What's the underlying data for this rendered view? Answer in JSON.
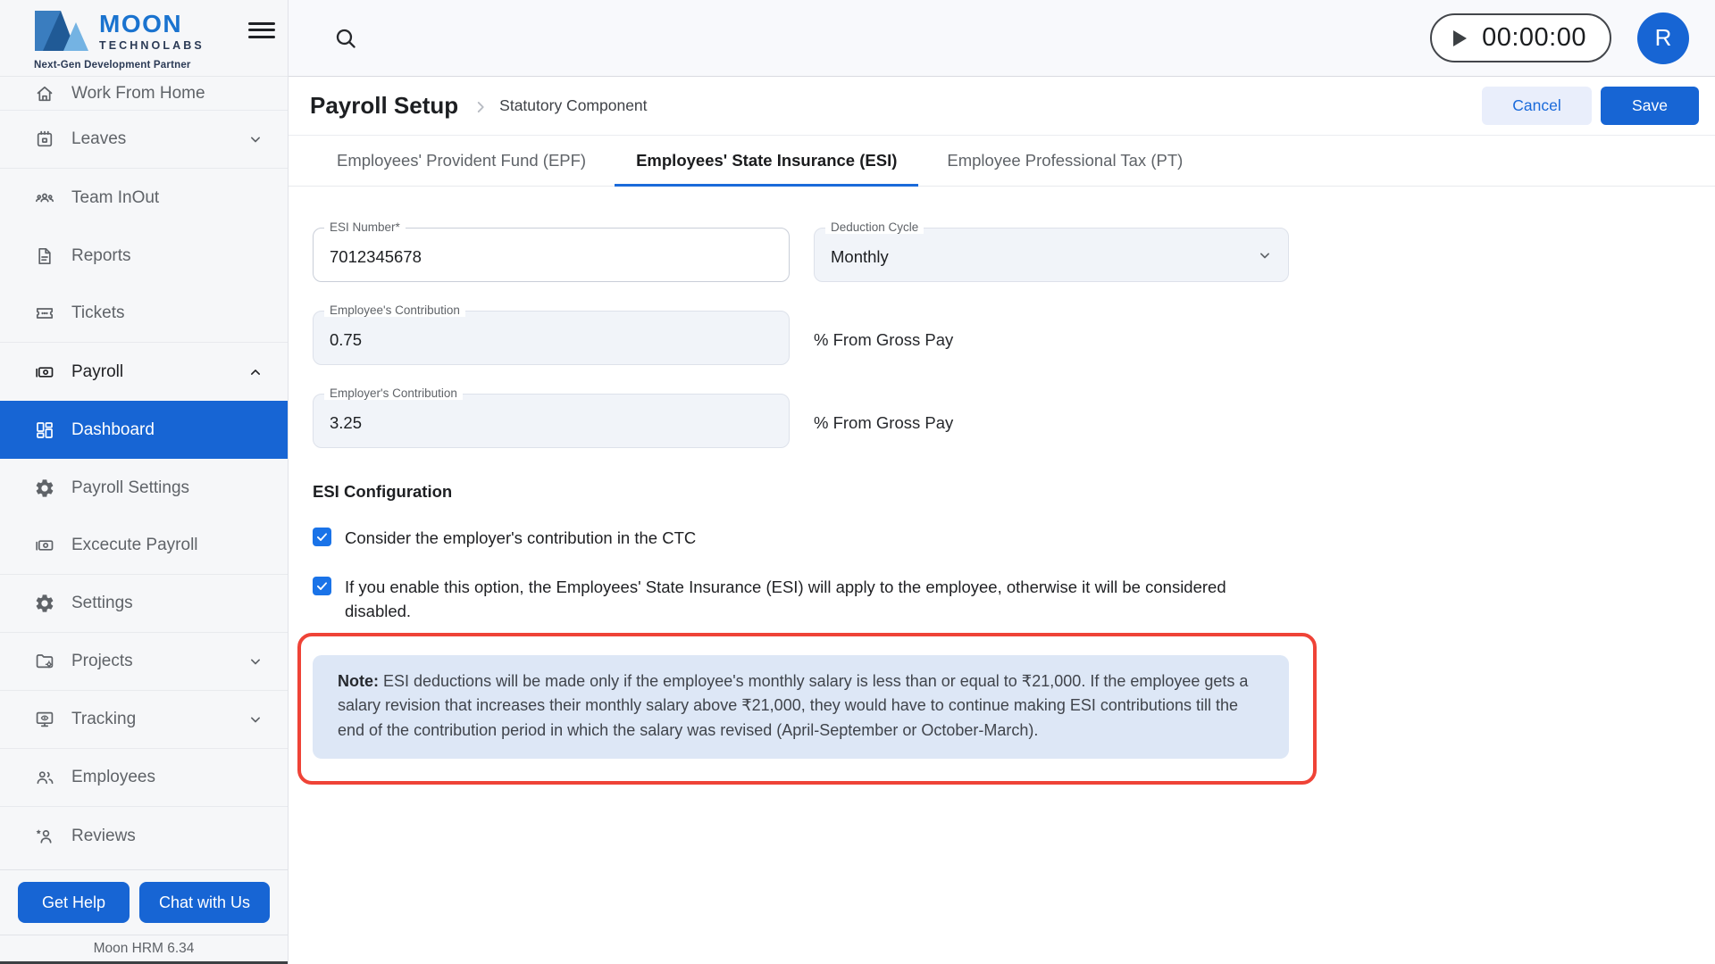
{
  "brand": {
    "name": "MOON",
    "subname": "TECHNOLABS",
    "tagline": "Next-Gen Development Partner"
  },
  "topbar": {
    "timer": "00:00:00",
    "avatar_initial": "R"
  },
  "sidebar": {
    "items": [
      {
        "label": "Work From Home",
        "icon": "home-icon"
      },
      {
        "label": "Leaves",
        "icon": "calendar-icon",
        "chevron": "down"
      },
      {
        "label": "Team InOut",
        "icon": "groups-icon"
      },
      {
        "label": "Reports",
        "icon": "document-icon"
      },
      {
        "label": "Tickets",
        "icon": "ticket-icon"
      },
      {
        "label": "Payroll",
        "icon": "payments-icon",
        "chevron": "up",
        "expanded": true
      },
      {
        "label": "Dashboard",
        "icon": "dashboard-icon",
        "active": true
      },
      {
        "label": "Payroll Settings",
        "icon": "gear-icon"
      },
      {
        "label": "Excecute Payroll",
        "icon": "payments-icon"
      },
      {
        "label": "Settings",
        "icon": "gear-icon"
      },
      {
        "label": "Projects",
        "icon": "folder-gear-icon",
        "chevron": "down"
      },
      {
        "label": "Tracking",
        "icon": "monitor-eye-icon",
        "chevron": "down"
      },
      {
        "label": "Employees",
        "icon": "people-icon"
      },
      {
        "label": "Reviews",
        "icon": "person-star-icon"
      }
    ],
    "get_help": "Get Help",
    "chat_with_us": "Chat with Us",
    "version": "Moon HRM 6.34"
  },
  "page_header": {
    "title": "Payroll Setup",
    "breadcrumb": "Statutory Component",
    "cancel_label": "Cancel",
    "save_label": "Save"
  },
  "tabs": [
    {
      "label": "Employees' Provident Fund (EPF)",
      "active": false
    },
    {
      "label": "Employees' State Insurance (ESI)",
      "active": true
    },
    {
      "label": "Employee Professional Tax (PT)",
      "active": false
    }
  ],
  "form": {
    "esi_number": {
      "label": "ESI Number*",
      "value": "7012345678"
    },
    "deduction_cycle": {
      "label": "Deduction Cycle",
      "value": "Monthly"
    },
    "employee_contribution": {
      "label": "Employee's Contribution",
      "value": "0.75",
      "suffix": "% From Gross Pay"
    },
    "employer_contribution": {
      "label": "Employer's Contribution",
      "value": "3.25",
      "suffix": "% From Gross Pay"
    },
    "config_title": "ESI Configuration",
    "checkbox1": {
      "checked": true,
      "label": "Consider the employer's contribution in the CTC"
    },
    "checkbox2": {
      "checked": true,
      "label": "If you enable this option, the Employees' State Insurance (ESI) will apply to the employee, otherwise it will be considered disabled."
    },
    "note": {
      "prefix": "Note:",
      "text": " ESI deductions will be made only if the employee's monthly salary is less than or equal to ₹21,000. If the employee gets a salary revision that increases their monthly salary above ₹21,000, they would have to continue making ESI contributions till the end of the contribution period in which the salary was revised (April-September or October-March)."
    }
  },
  "colors": {
    "primary_blue": "#1765d4",
    "checkbox_blue": "#1a73e8",
    "annotation_red": "#ef4337",
    "note_background": "#dde7f6",
    "logo_blue": "#1a73cf",
    "logo_navy": "#2b3a55"
  }
}
